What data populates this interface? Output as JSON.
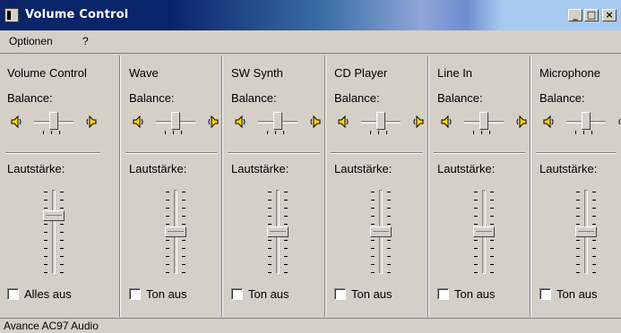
{
  "window": {
    "title": "Volume Control"
  },
  "menu": [
    {
      "label": "Optionen"
    },
    {
      "label": "?"
    }
  ],
  "labels": {
    "balance": "Balance:",
    "volume": "Lautstärke:"
  },
  "channels": [
    {
      "name": "Volume Control",
      "mute_label": "Alles aus",
      "muted": false,
      "balance": 0.5,
      "volume": 0.72
    },
    {
      "name": "Wave",
      "mute_label": "Ton aus",
      "muted": false,
      "balance": 0.5,
      "volume": 0.5
    },
    {
      "name": "SW Synth",
      "mute_label": "Ton aus",
      "muted": false,
      "balance": 0.5,
      "volume": 0.5
    },
    {
      "name": "CD Player",
      "mute_label": "Ton aus",
      "muted": false,
      "balance": 0.5,
      "volume": 0.5
    },
    {
      "name": "Line In",
      "mute_label": "Ton aus",
      "muted": false,
      "balance": 0.5,
      "volume": 0.5
    },
    {
      "name": "Microphone",
      "mute_label": "Ton aus",
      "muted": false,
      "balance": 0.5,
      "volume": 0.5
    }
  ],
  "statusbar": {
    "text": "Avance AC97 Audio"
  }
}
